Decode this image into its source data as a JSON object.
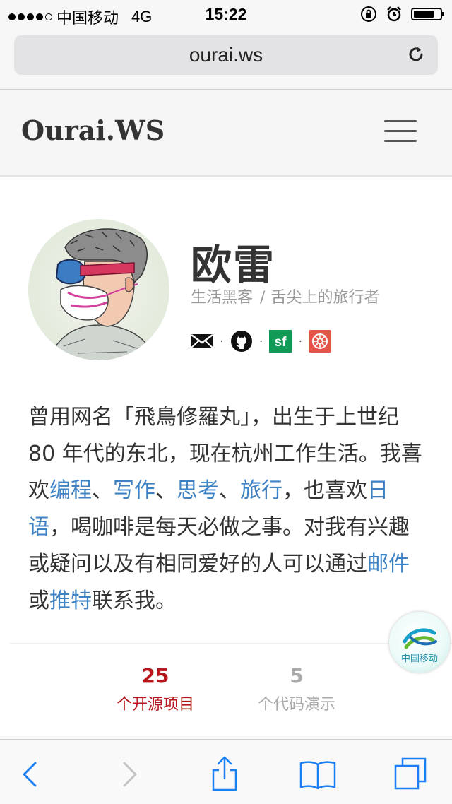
{
  "status_bar": {
    "carrier": "中国移动",
    "network": "4G",
    "time": "15:22",
    "icons": [
      "orientation-lock-icon",
      "alarm-icon",
      "battery-icon"
    ]
  },
  "browser": {
    "url": "ourai.ws",
    "reload_icon": "reload-icon"
  },
  "site": {
    "logo": "Ourai.WS",
    "menu_icon": "hamburger-menu-icon"
  },
  "profile": {
    "name": "欧雷",
    "tagline_part1": "生活黑客",
    "tagline_sep": "/",
    "tagline_part2": "舌尖上的旅行者",
    "social": [
      {
        "icon": "mail-icon"
      },
      {
        "icon": "github-icon"
      },
      {
        "icon": "segmentfault-icon",
        "text": "sf"
      },
      {
        "icon": "weibo-icon"
      }
    ],
    "dot": "·"
  },
  "bio": {
    "t1": "曾用网名「飛鳥修羅丸」，出生于上世纪 80 年代的东北，现在杭州工作生活。我喜欢",
    "l1": "编程",
    "s1": "、",
    "l2": "写作",
    "s2": "、",
    "l3": "思考",
    "s3": "、",
    "l4": "旅行",
    "t2": "，也喜欢",
    "l5": "日语",
    "t3": "，喝咖啡是每天必做之事。对我有兴趣或疑问以及有相同爱好的人可以通过",
    "l6": "邮件",
    "t4": "或",
    "l7": "推特",
    "t5": "联系我。"
  },
  "stats": {
    "projects_count": "25",
    "projects_label": "个开源项目",
    "demos_count": "5",
    "demos_label": "个代码演示"
  },
  "floating_badge": {
    "label": "中国移动"
  },
  "toolbar": {
    "icons": [
      "back-icon",
      "forward-icon",
      "share-icon",
      "bookmarks-icon",
      "tabs-icon"
    ]
  },
  "colors": {
    "link": "#3e82c4",
    "accent_red": "#b5171d",
    "ios_blue": "#1a7ef4"
  }
}
